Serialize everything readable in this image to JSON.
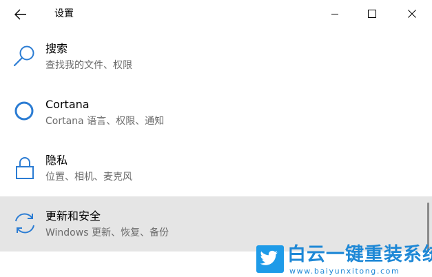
{
  "window": {
    "title": "设置"
  },
  "items": [
    {
      "label": "搜索",
      "description": "查找我的文件、权限",
      "icon": "search-icon"
    },
    {
      "label": "Cortana",
      "description": "Cortana 语言、权限、通知",
      "icon": "cortana-icon"
    },
    {
      "label": "隐私",
      "description": "位置、相机、麦克风",
      "icon": "lock-icon"
    },
    {
      "label": "更新和安全",
      "description": "Windows 更新、恢复、备份",
      "icon": "sync-icon",
      "selected": true
    }
  ],
  "watermark": {
    "title": "白云一键重装系统",
    "url": "www.baiyunxitong.com",
    "icon": "twitter-bird-icon"
  },
  "colors": {
    "accent": "#2b7cd3",
    "selected_bg": "#e5e5e5",
    "description_text": "#6b6b6b",
    "watermark_blue": "#1e88d6"
  }
}
